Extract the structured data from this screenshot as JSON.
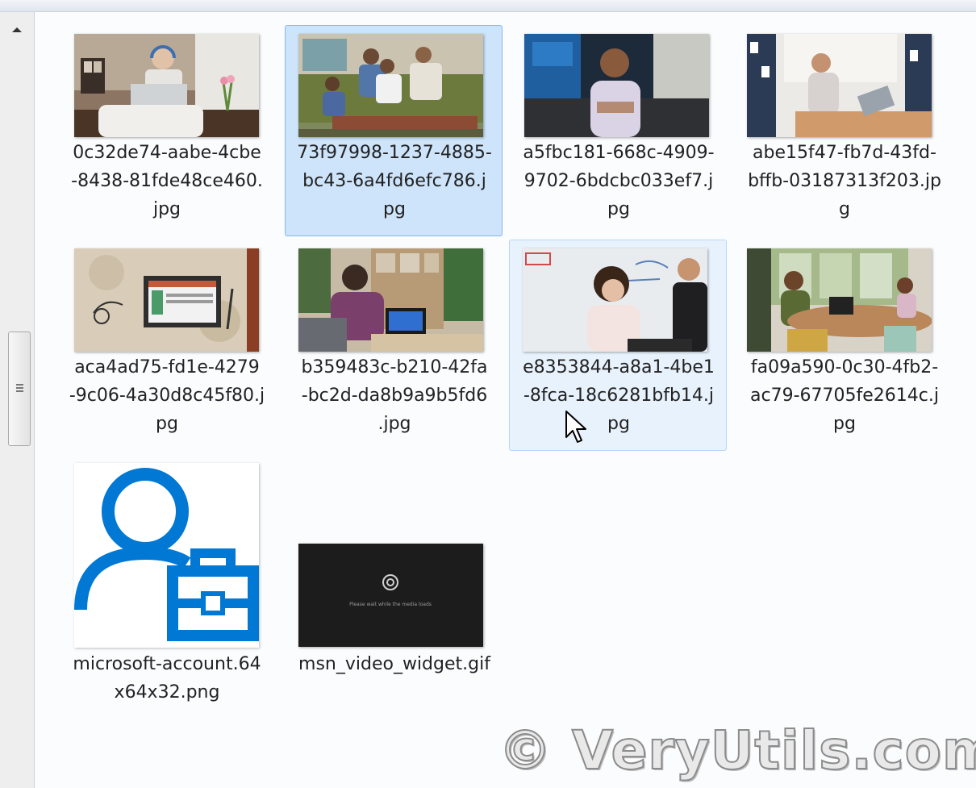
{
  "files": [
    {
      "name": "0c32de74-aabe-4cbe-8438-81fde48ce460.jpg",
      "display": "0c32de74-aabe-4cbe\n-8438-81fde48ce460.\njpg",
      "state": "normal"
    },
    {
      "name": "73f97998-1237-4885-bc43-6a4fd6efc786.jpg",
      "display": "73f97998-1237-4885-\nbc43-6a4fd6efc786.j\npg",
      "state": "selected"
    },
    {
      "name": "a5fbc181-668c-4909-9702-6bdcbc033ef7.jpg",
      "display": "a5fbc181-668c-4909-\n9702-6bdcbc033ef7.j\npg",
      "state": "normal"
    },
    {
      "name": "abe15f47-fb7d-43fd-bffb-03187313f203.jpg",
      "display": "abe15f47-fb7d-43fd-\nbffb-03187313f203.jp\ng",
      "state": "normal"
    },
    {
      "name": "aca4ad75-fd1e-4279-9c06-4a30d8c45f80.jpg",
      "display": "aca4ad75-fd1e-4279\n-9c06-4a30d8c45f80.j\npg",
      "state": "normal"
    },
    {
      "name": "b359483c-b210-42fa-bc2d-da8b9a9b5fd6.jpg",
      "display": "b359483c-b210-42fa\n-bc2d-da8b9a9b5fd6\n.jpg",
      "state": "normal"
    },
    {
      "name": "e8353844-a8a1-4be1-8fca-18c6281bfb14.jpg",
      "display": "e8353844-a8a1-4be1\n-8fca-18c6281bfb14.j\npg",
      "state": "hover"
    },
    {
      "name": "fa09a590-0c30-4fb2-ac79-67705fe2614c.jpg",
      "display": "fa09a590-0c30-4fb2-\nac79-67705fe2614c.j\npg",
      "state": "normal"
    },
    {
      "name": "microsoft-account.64x64x32.png",
      "display": "microsoft-account.64\nx64x32.png",
      "state": "normal"
    },
    {
      "name": "msn_video_widget.gif",
      "display": "msn_video_widget.gif",
      "state": "normal"
    }
  ],
  "video_widget_text": "Please wait while the media loads",
  "watermark": "© VeryUtils.com",
  "colors": {
    "selection": "#cde4fb",
    "hover": "#e8f2fc",
    "ms_blue": "#0078d4"
  }
}
